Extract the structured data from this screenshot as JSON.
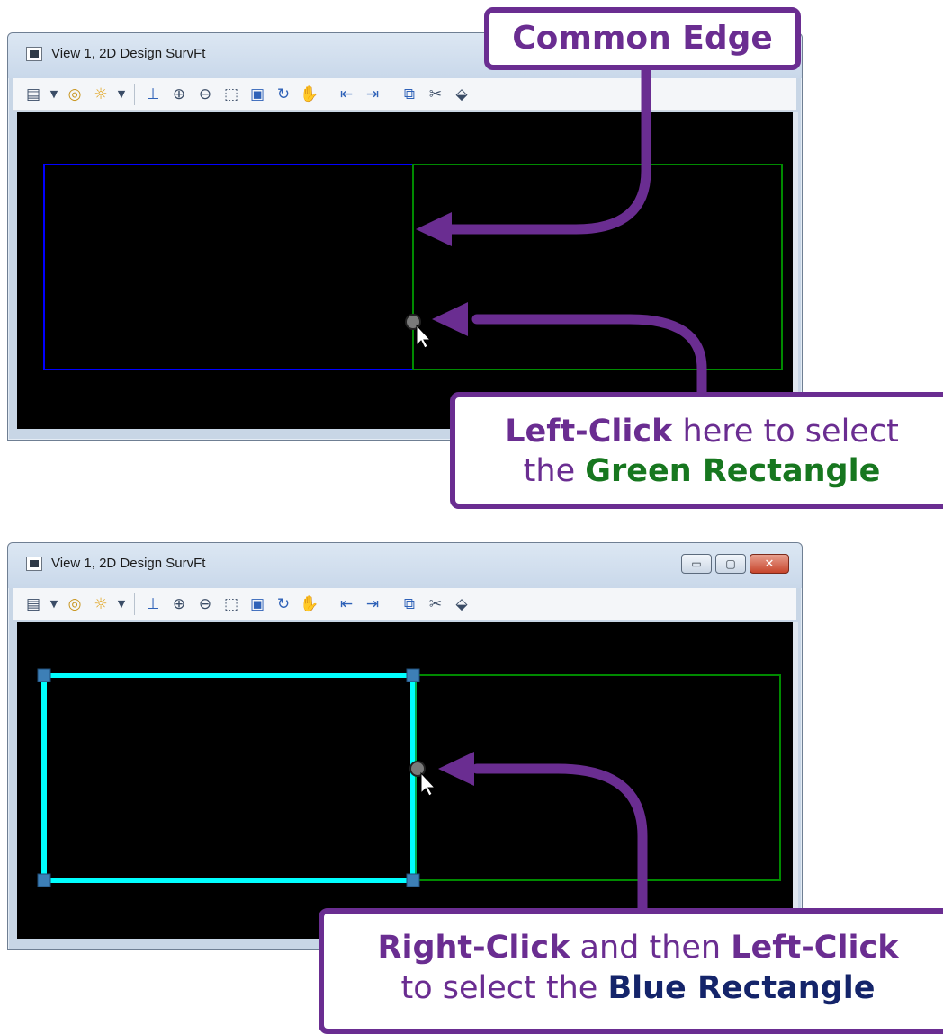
{
  "window": {
    "title": "View 1, 2D Design SurvFt",
    "controls": {
      "minimize": "▭",
      "maximize": "▢",
      "close": "✕"
    }
  },
  "toolbar": {
    "icons": [
      "view-attributes-icon",
      "dropdown-icon",
      "levels-icon",
      "lighting-icon",
      "dropdown-icon",
      "update-view-icon",
      "zoom-in-icon",
      "zoom-out-icon",
      "window-area-icon",
      "fit-view-icon",
      "rotate-view-icon",
      "pan-view-icon",
      "previous-view-icon",
      "next-view-icon",
      "copy-view-icon",
      "clip-volume-icon",
      "clip-mask-icon"
    ]
  },
  "colors": {
    "blue_rect": "#0000ff",
    "green_rect": "#008a00",
    "cyan_highlight": "#00ffff",
    "callout_purple": "#6a2d91"
  },
  "callouts": {
    "common_edge": "Common Edge",
    "left_click": {
      "bold": "Left-Click",
      "rest1": " here to select",
      "pre": "the ",
      "target": "Green Rectangle"
    },
    "right_click": {
      "bold1": "Right-Click",
      "mid": " and then ",
      "bold2": "Left-Click",
      "pre": "to select the ",
      "target": "Blue Rectangle"
    }
  }
}
